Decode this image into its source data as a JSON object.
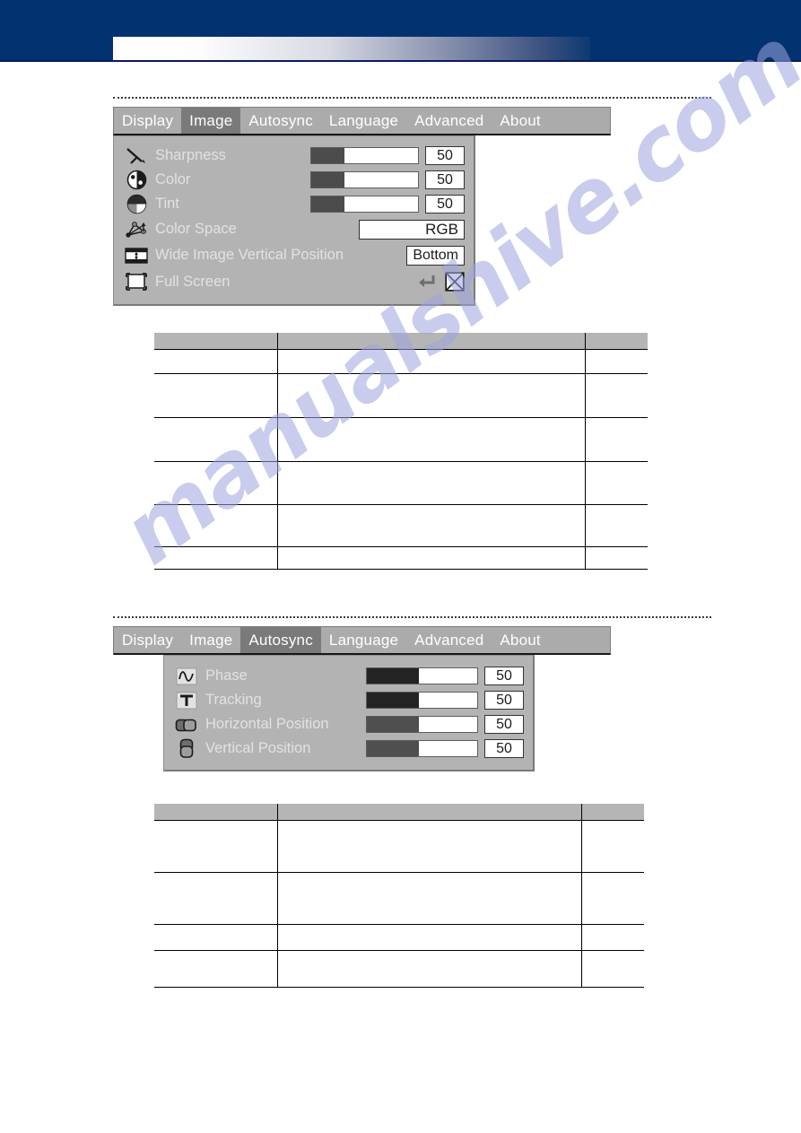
{
  "header": {
    "band_color": "#023370",
    "gradient_from": "#ffffff",
    "gradient_to": "#0c3a72"
  },
  "watermark": {
    "text": "manualshive.com",
    "color": "#9ea4de"
  },
  "menus": [
    {
      "id": "image-menu",
      "tabs": [
        {
          "label": "Display",
          "active": false
        },
        {
          "label": "Image",
          "active": true
        },
        {
          "label": "Autosync",
          "active": false
        },
        {
          "label": "Language",
          "active": false
        },
        {
          "label": "Advanced",
          "active": false
        },
        {
          "label": "About",
          "active": false
        }
      ],
      "rows": [
        {
          "icon": "sharpness-icon",
          "label": "Sharpness",
          "control": "slider",
          "value": "50",
          "fill_percent": 31,
          "fill_color": "#4c4c4c"
        },
        {
          "icon": "color-wheel-icon",
          "label": "Color",
          "control": "slider",
          "value": "50",
          "fill_percent": 31,
          "fill_color": "#4c4c4c"
        },
        {
          "icon": "tint-icon",
          "label": "Tint",
          "control": "slider",
          "value": "50",
          "fill_percent": 31,
          "fill_color": "#4c4c4c"
        },
        {
          "icon": "color-space-icon",
          "label": "Color Space",
          "control": "select",
          "value": "RGB"
        },
        {
          "icon": "wide-image-position-icon",
          "label": "Wide Image Vertical Position",
          "control": "button",
          "value": "Bottom"
        },
        {
          "icon": "full-screen-icon",
          "label": "Full Screen",
          "control": "toggle",
          "value": ""
        }
      ]
    },
    {
      "id": "autosync-menu",
      "tabs": [
        {
          "label": "Display",
          "active": false
        },
        {
          "label": "Image",
          "active": false
        },
        {
          "label": "Autosync",
          "active": true
        },
        {
          "label": "Language",
          "active": false
        },
        {
          "label": "Advanced",
          "active": false
        },
        {
          "label": "About",
          "active": false
        }
      ],
      "rows": [
        {
          "icon": "phase-icon",
          "label": "Phase",
          "control": "slider",
          "value": "50",
          "fill_percent": 47,
          "fill_color": "#232323"
        },
        {
          "icon": "tracking-icon",
          "label": "Tracking",
          "control": "slider",
          "value": "50",
          "fill_percent": 47,
          "fill_color": "#232323"
        },
        {
          "icon": "horizontal-position-icon",
          "label": "Horizontal Position",
          "control": "slider",
          "value": "50",
          "fill_percent": 47,
          "fill_color": "#4f4f4f"
        },
        {
          "icon": "vertical-position-icon",
          "label": "Vertical Position",
          "control": "slider",
          "value": "50",
          "fill_percent": 47,
          "fill_color": "#4f4f4f"
        }
      ]
    }
  ],
  "tables": [
    {
      "id": "image-menu-table",
      "header_bg": "#b5b5b5",
      "columns": [
        "",
        "",
        ""
      ],
      "rows": [
        [
          "",
          "",
          ""
        ],
        [
          "",
          "",
          ""
        ],
        [
          "",
          "",
          ""
        ],
        [
          "",
          "",
          ""
        ],
        [
          "",
          "",
          ""
        ],
        [
          "",
          "",
          ""
        ]
      ]
    },
    {
      "id": "autosync-menu-table",
      "header_bg": "#b5b5b5",
      "columns": [
        "",
        "",
        ""
      ],
      "rows": [
        [
          "",
          "",
          ""
        ],
        [
          "",
          "",
          ""
        ],
        [
          "",
          "",
          ""
        ],
        [
          "",
          "",
          ""
        ]
      ]
    }
  ]
}
